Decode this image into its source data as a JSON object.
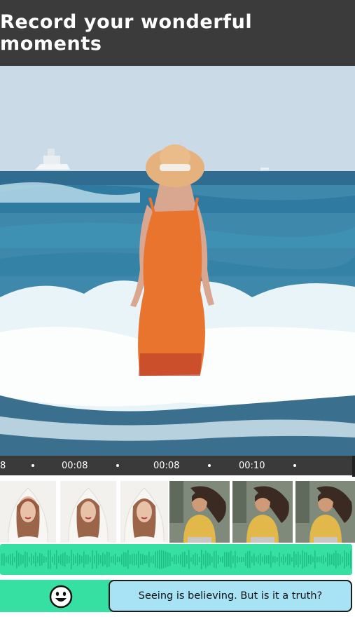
{
  "header": {
    "title": "Record your wonderful moments"
  },
  "timeline": {
    "ticks": [
      "8",
      "00:08",
      "00:08",
      "00:10"
    ]
  },
  "thumbnails": {
    "count_portrait": 3,
    "count_city": 3
  },
  "caption": {
    "text": "Seeing is believing. But is it a truth?",
    "emoji_icon": "smiley-face-icon"
  },
  "colors": {
    "accent_green": "#35e0a2",
    "bubble_blue": "#a7e3f4",
    "header_bg": "#3b3b3b"
  }
}
